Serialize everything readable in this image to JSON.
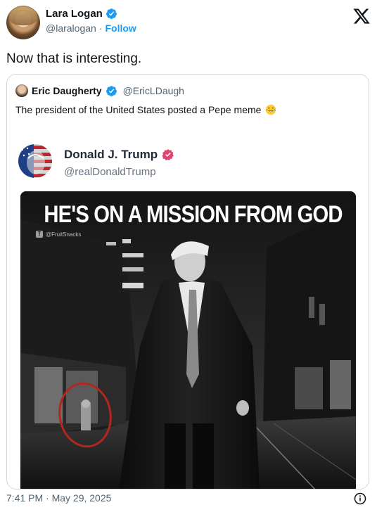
{
  "author": {
    "name": "Lara Logan",
    "handle": "@laralogan",
    "separator": "·",
    "follow_label": "Follow",
    "avatar_icon": "profile-photo",
    "verified_icon": "verified-badge-icon"
  },
  "tweet": {
    "text": "Now that is interesting."
  },
  "quote": {
    "name": "Eric Daugherty",
    "handle": "@EricLDaugh",
    "text": "The president of the United States posted a Pepe meme",
    "emoji": "laughing-tears-emoji"
  },
  "embed": {
    "name": "Donald J. Trump",
    "handle": "@realDonaldTrump",
    "badge_icon": "truth-verified-badge-icon",
    "meme_title": "HE'S ON A MISSION FROM GOD",
    "watermark": "@FruitSnacks",
    "watermark_badge": "T"
  },
  "footer": {
    "timestamp": "7:41 PM · May 29, 2025",
    "info_icon": "info-icon"
  },
  "colors": {
    "link_blue": "#1d9bf0",
    "text_primary": "#0f1419",
    "text_secondary": "#536471",
    "border": "#cfd9de",
    "truth_badge": "#e3446f",
    "circle_red": "#b3261e"
  }
}
